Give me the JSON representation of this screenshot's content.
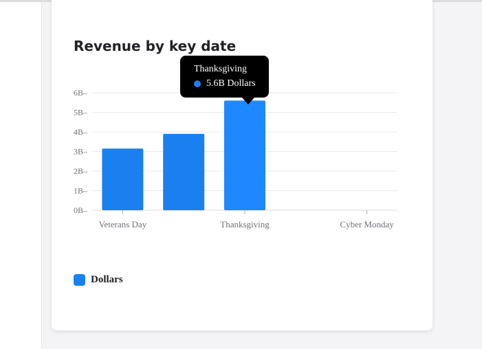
{
  "chart_data": {
    "type": "bar",
    "title": "Revenue by key date",
    "categories": [
      "Veterans Day",
      "",
      "Thanksgiving",
      "",
      "Cyber Monday"
    ],
    "series": [
      {
        "name": "Dollars",
        "values": [
          3.15,
          3.9,
          5.6,
          null,
          null
        ]
      }
    ],
    "value_suffix": "B",
    "yticks": [
      "0B",
      "1B",
      "2B",
      "3B",
      "4B",
      "5B",
      "6B"
    ],
    "ylim": [
      0,
      6
    ],
    "grid": true,
    "legend_position": "bottom-left",
    "bar_color": "#1a80f0",
    "highlight_color": "#1e88ff"
  },
  "tooltip": {
    "title": "Thanksgiving",
    "value_label": "5.6B Dollars",
    "dot_color": "#1a80f0"
  },
  "legend": {
    "label": "Dollars",
    "color": "#1a80f0"
  }
}
